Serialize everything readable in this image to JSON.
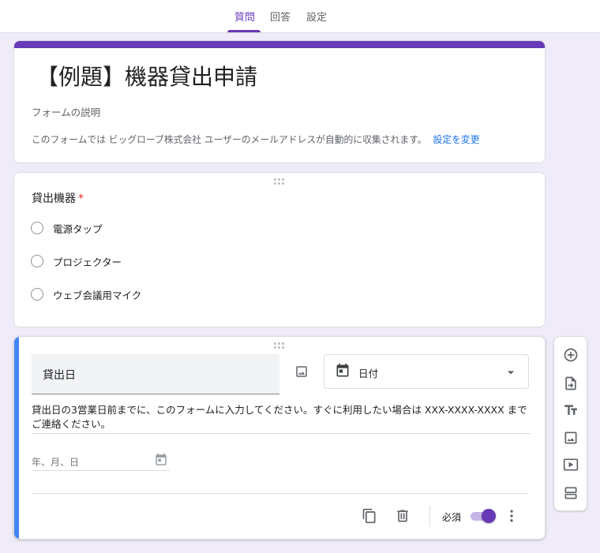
{
  "tabs": [
    {
      "label": "質問",
      "active": true
    },
    {
      "label": "回答",
      "active": false
    },
    {
      "label": "設定",
      "active": false
    }
  ],
  "form": {
    "title": "【例題】機器貸出申請",
    "description_placeholder": "フォームの説明",
    "collect_note": "このフォームでは ビッグローブ株式会社 ユーザーのメールアドレスが自動的に収集されます。",
    "change_settings_link": "設定を変更"
  },
  "question1": {
    "title": "貸出機器",
    "required_mark": "*",
    "options": [
      "電源タップ",
      "プロジェクター",
      "ウェブ会議用マイク"
    ]
  },
  "question2": {
    "title": "貸出日",
    "type_label": "日付",
    "description": "貸出日の3営業日前までに、このフォームに入力してください。すぐに利用したい場合は XXX-XXXX-XXXX までご連絡ください。",
    "date_placeholder": "年、月、日",
    "required_label": "必須",
    "required_on": true
  },
  "toolbar": [
    "add-question",
    "import-questions",
    "add-title-description",
    "add-image",
    "add-video",
    "add-section"
  ],
  "colors": {
    "accent": "#673ab7",
    "background": "#f0ebf8",
    "active_question_bar": "#4285f4",
    "link": "#1a73e8",
    "required": "#d93025"
  }
}
